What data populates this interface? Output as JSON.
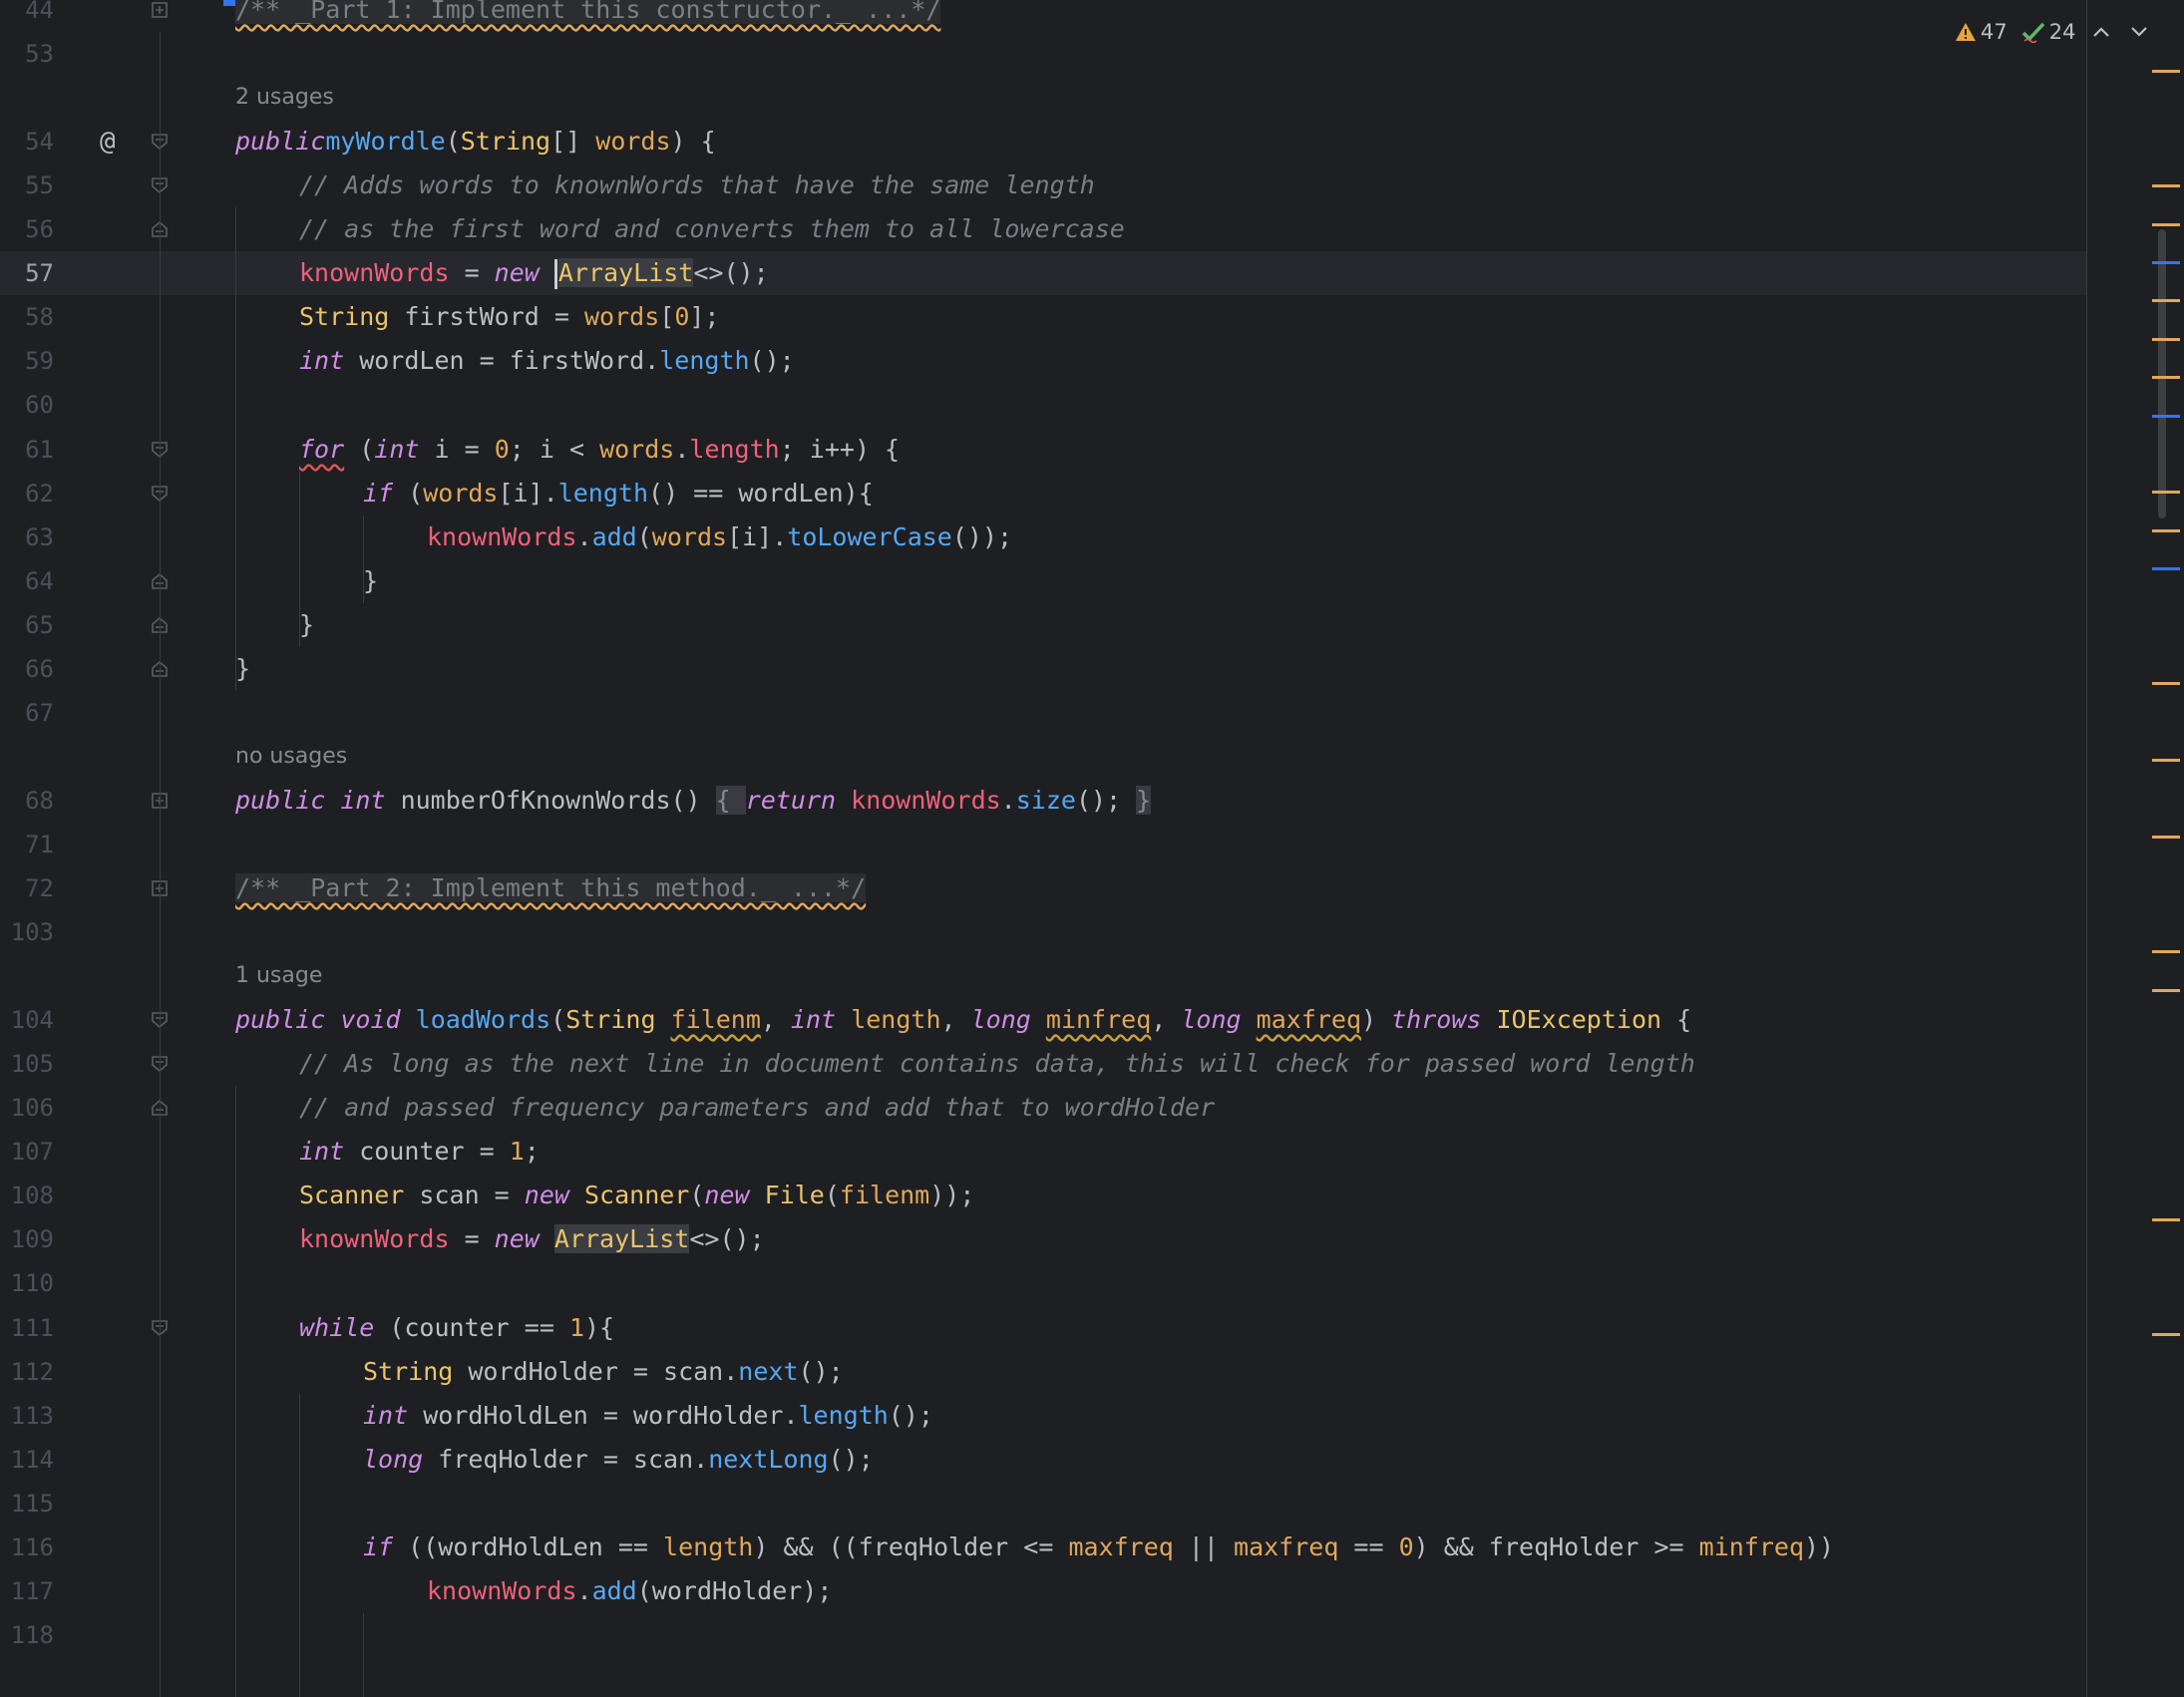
{
  "inspections": {
    "warnings": "47",
    "ok": "24"
  },
  "colors": {
    "background": "#1e1f22",
    "keyword": "#cf8ee6",
    "method": "#56a8f5",
    "type": "#e9c46a",
    "field": "#f0617a",
    "parameter": "#e0a85a",
    "comment": "#7a7e85",
    "warning_marker": "#e0a85a",
    "info_marker": "#3574f0"
  },
  "icons": {
    "warning": "warning-triangle-icon",
    "ok": "check-icon",
    "prev": "chevron-up-icon",
    "next": "chevron-down-icon",
    "fold": "fold-icon",
    "override": "at-icon"
  },
  "lines": [
    {
      "n": "44"
    },
    {
      "n": "53"
    },
    {
      "hint": "2 usages"
    },
    {
      "n": "54"
    },
    {
      "n": "55"
    },
    {
      "n": "56"
    },
    {
      "n": "57"
    },
    {
      "n": "58"
    },
    {
      "n": "59"
    },
    {
      "n": "60"
    },
    {
      "n": "61"
    },
    {
      "n": "62"
    },
    {
      "n": "63"
    },
    {
      "n": "64"
    },
    {
      "n": "65"
    },
    {
      "n": "66"
    },
    {
      "n": "67"
    },
    {
      "hint": "no usages"
    },
    {
      "n": "68"
    },
    {
      "n": "71"
    },
    {
      "n": "72"
    },
    {
      "n": "103"
    },
    {
      "hint": "1 usage"
    },
    {
      "n": "104"
    },
    {
      "n": "105"
    },
    {
      "n": "106"
    },
    {
      "n": "107"
    },
    {
      "n": "108"
    },
    {
      "n": "109"
    },
    {
      "n": "110"
    },
    {
      "n": "111"
    },
    {
      "n": "112"
    },
    {
      "n": "113"
    },
    {
      "n": "114"
    },
    {
      "n": "115"
    },
    {
      "n": "116"
    },
    {
      "n": "117"
    },
    {
      "n": "118"
    }
  ],
  "code": {
    "l44": "/** _Part 1: Implement this constructor._ ...*/",
    "hint_54": "2 usages",
    "l54": [
      "public",
      "myWordle",
      "(",
      "String",
      "[] ",
      "words",
      ") {"
    ],
    "l55": "// Adds words to knownWords that have the same length",
    "l56": "// as the first word and converts them to all lowercase",
    "l57": [
      "knownWords",
      " = ",
      "new",
      " ",
      "ArrayList",
      "<>();"
    ],
    "l58": [
      "String",
      " firstWord = ",
      "words",
      "[",
      "0",
      "];"
    ],
    "l59": [
      "int",
      " wordLen = firstWord.",
      "length",
      "();"
    ],
    "l61": [
      "for",
      " (",
      "int",
      " i = ",
      "0",
      "; i < ",
      "words",
      ".",
      "length",
      "; i++) {"
    ],
    "l62": [
      "if",
      " (",
      "words",
      "[i].",
      "length",
      "() == wordLen){"
    ],
    "l63": [
      "knownWords",
      ".",
      "add",
      "(",
      "words",
      "[i].",
      "toLowerCase",
      "());"
    ],
    "l64": "}",
    "l65": "}",
    "l66": "}",
    "hint_68": "no usages",
    "l68": [
      "public",
      " ",
      "int",
      " numberOfKnownWords() ",
      "{ ",
      "return",
      " ",
      "knownWords",
      ".",
      "size",
      "(); ",
      "}"
    ],
    "l72": "/** _Part 2: Implement this method._ ...*/",
    "hint_104": "1 usage",
    "l104": [
      "public",
      " ",
      "void",
      " ",
      "loadWords",
      "(",
      "String",
      " ",
      "filenm",
      ", ",
      "int",
      " ",
      "length",
      ", ",
      "long",
      " ",
      "minfreq",
      ", ",
      "long",
      " ",
      "maxfreq",
      ") ",
      "throws",
      " ",
      "IOException",
      " {"
    ],
    "l105": "// As long as the next line in document contains data, this will check for passed word length",
    "l106": "// and passed frequency parameters and add that to wordHolder",
    "l107": [
      "int",
      " counter = ",
      "1",
      ";"
    ],
    "l108": [
      "Scanner",
      " scan = ",
      "new",
      " ",
      "Scanner",
      "(",
      "new",
      " ",
      "File",
      "(",
      "filenm",
      "));"
    ],
    "l109": [
      "knownWords",
      " = ",
      "new",
      " ",
      "ArrayList",
      "<>();"
    ],
    "l111": [
      "while",
      " (counter == ",
      "1",
      "){"
    ],
    "l112": [
      "String",
      " wordHolder = scan.",
      "next",
      "();"
    ],
    "l113": [
      "int",
      " wordHoldLen = wordHolder.",
      "length",
      "();"
    ],
    "l114": [
      "long",
      " freqHolder = scan.",
      "nextLong",
      "();"
    ],
    "l116": [
      "if",
      " ((wordHoldLen == ",
      "length",
      ") && ((freqHolder <= ",
      "maxfreq",
      " || ",
      "maxfreq",
      " == ",
      "0",
      ") && freqHolder >= ",
      "minfreq",
      "))"
    ],
    "l117": [
      "knownWords",
      ".",
      "add",
      "(wordHolder);"
    ]
  },
  "markers": [
    {
      "kind": "warn",
      "line": "44"
    },
    {
      "kind": "warn",
      "line": "54"
    },
    {
      "kind": "warn",
      "line": "55"
    },
    {
      "kind": "info",
      "line": "56"
    },
    {
      "kind": "warn",
      "line": "57"
    },
    {
      "kind": "warn",
      "line": "58"
    },
    {
      "kind": "warn",
      "line": "59"
    },
    {
      "kind": "info",
      "line": "60"
    },
    {
      "kind": "warn",
      "line": "62"
    },
    {
      "kind": "warn",
      "line": "63"
    },
    {
      "kind": "info",
      "line": "64"
    },
    {
      "kind": "warn",
      "line": "67"
    },
    {
      "kind": "warn",
      "line": "68"
    },
    {
      "kind": "warn",
      "line": "72"
    },
    {
      "kind": "warn",
      "line": "104"
    },
    {
      "kind": "warn",
      "line": "105"
    },
    {
      "kind": "warn",
      "line": "111"
    },
    {
      "kind": "warn",
      "line": "114"
    }
  ]
}
